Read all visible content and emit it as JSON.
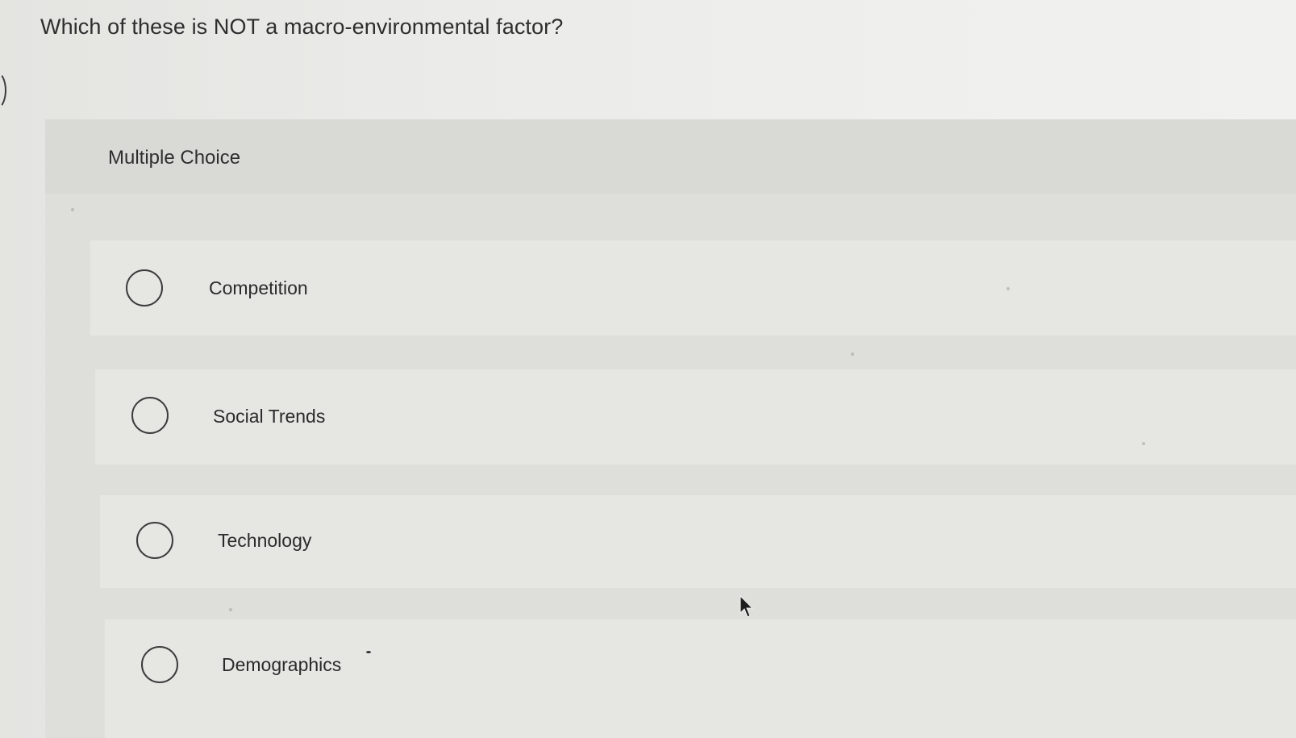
{
  "question": {
    "text": "Which of these is NOT a macro-environmental factor?"
  },
  "panel": {
    "type_label": "Multiple Choice"
  },
  "choices": [
    {
      "label": "Competition",
      "selected": false
    },
    {
      "label": "Social Trends",
      "selected": false
    },
    {
      "label": "Technology",
      "selected": false
    },
    {
      "label": "Demographics",
      "selected": false
    }
  ],
  "colors": {
    "background": "#ebebe9",
    "panel": "#dededb",
    "choice_row": "#e6e6e3",
    "text": "#2b2b2b"
  },
  "icons": {
    "radio": "radio-empty-icon",
    "cursor": "mouse-pointer-icon"
  }
}
